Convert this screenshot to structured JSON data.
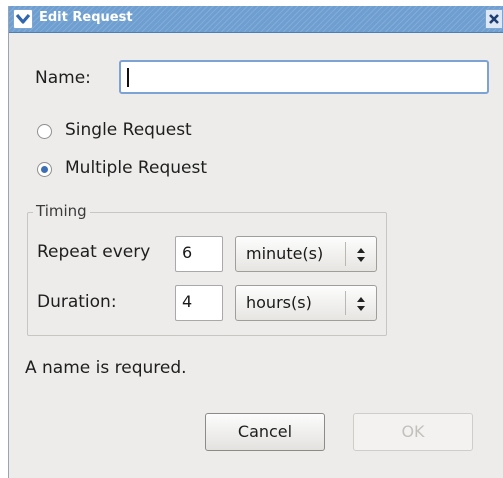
{
  "window": {
    "title": "Edit Request"
  },
  "name_field": {
    "label": "Name:",
    "value": ""
  },
  "request_type": {
    "options": [
      {
        "label": "Single Request",
        "selected": false
      },
      {
        "label": "Multiple Request",
        "selected": true
      }
    ]
  },
  "timing": {
    "title": "Timing",
    "repeat": {
      "label": "Repeat every",
      "value": "6",
      "unit": "minute(s)"
    },
    "duration": {
      "label": "Duration:",
      "value": "4",
      "unit": "hours(s)"
    }
  },
  "status": {
    "message": "A name is requred."
  },
  "buttons": {
    "cancel": "Cancel",
    "ok": "OK",
    "ok_enabled": false
  },
  "colors": {
    "titlebar": "#6e9fd0",
    "accent": "#3d6fb5",
    "dialog_bg": "#edecea"
  }
}
